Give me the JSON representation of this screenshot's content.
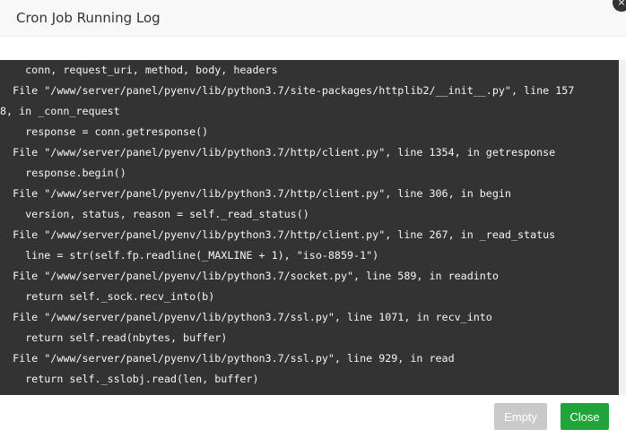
{
  "window": {
    "title": "Cron Job Running Log",
    "close_icon": "×"
  },
  "log": {
    "lines": [
      "    conn, request_uri, method, body, headers",
      "  File \"/www/server/panel/pyenv/lib/python3.7/site-packages/httplib2/__init__.py\", line 157",
      "8, in _conn_request",
      "    response = conn.getresponse()",
      "  File \"/www/server/panel/pyenv/lib/python3.7/http/client.py\", line 1354, in getresponse",
      "    response.begin()",
      "  File \"/www/server/panel/pyenv/lib/python3.7/http/client.py\", line 306, in begin",
      "    version, status, reason = self._read_status()",
      "  File \"/www/server/panel/pyenv/lib/python3.7/http/client.py\", line 267, in _read_status",
      "    line = str(self.fp.readline(_MAXLINE + 1), \"iso-8859-1\")",
      "  File \"/www/server/panel/pyenv/lib/python3.7/socket.py\", line 589, in readinto",
      "    return self._sock.recv_into(b)",
      "  File \"/www/server/panel/pyenv/lib/python3.7/ssl.py\", line 1071, in recv_into",
      "    return self.read(nbytes, buffer)",
      "  File \"/www/server/panel/pyenv/lib/python3.7/ssl.py\", line 929, in read",
      "    return self._sslobj.read(len, buffer)"
    ]
  },
  "footer": {
    "empty_label": "Empty",
    "close_label": "Close"
  },
  "colors": {
    "log_background": "#333333",
    "log_text": "#f5f5f5",
    "close_button": "#20a53a",
    "empty_button": "#c9c9c9"
  }
}
